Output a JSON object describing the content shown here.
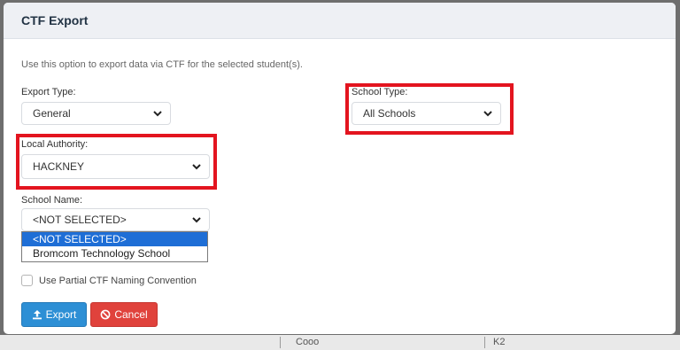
{
  "modal": {
    "title": "CTF Export",
    "intro": "Use this option to export data via CTF for the selected student(s)."
  },
  "fields": {
    "export_type": {
      "label": "Export Type:",
      "value": "General"
    },
    "school_type": {
      "label": "School Type:",
      "value": "All Schools"
    },
    "local_authority": {
      "label": "Local Authority:",
      "value": "HACKNEY"
    },
    "school_name": {
      "label": "School Name:",
      "value": "<NOT SELECTED>",
      "options": [
        "<NOT SELECTED>",
        "Bromcom Technology School"
      ]
    }
  },
  "checkbox": {
    "label": "Use Partial CTF Naming Convention",
    "checked": false
  },
  "buttons": {
    "export_label": "Export",
    "cancel_label": "Cancel"
  },
  "backdrop": {
    "cell_a": "Cooo",
    "cell_b": "K2"
  },
  "colors": {
    "highlight_border": "#e3141f",
    "export_button": "#2d8fd5",
    "cancel_button": "#e0423c",
    "selected_option": "#1e6ed6"
  },
  "icons": {
    "export": "upload-icon",
    "cancel": "ban-icon",
    "dropdown": "chevron-down-icon"
  }
}
